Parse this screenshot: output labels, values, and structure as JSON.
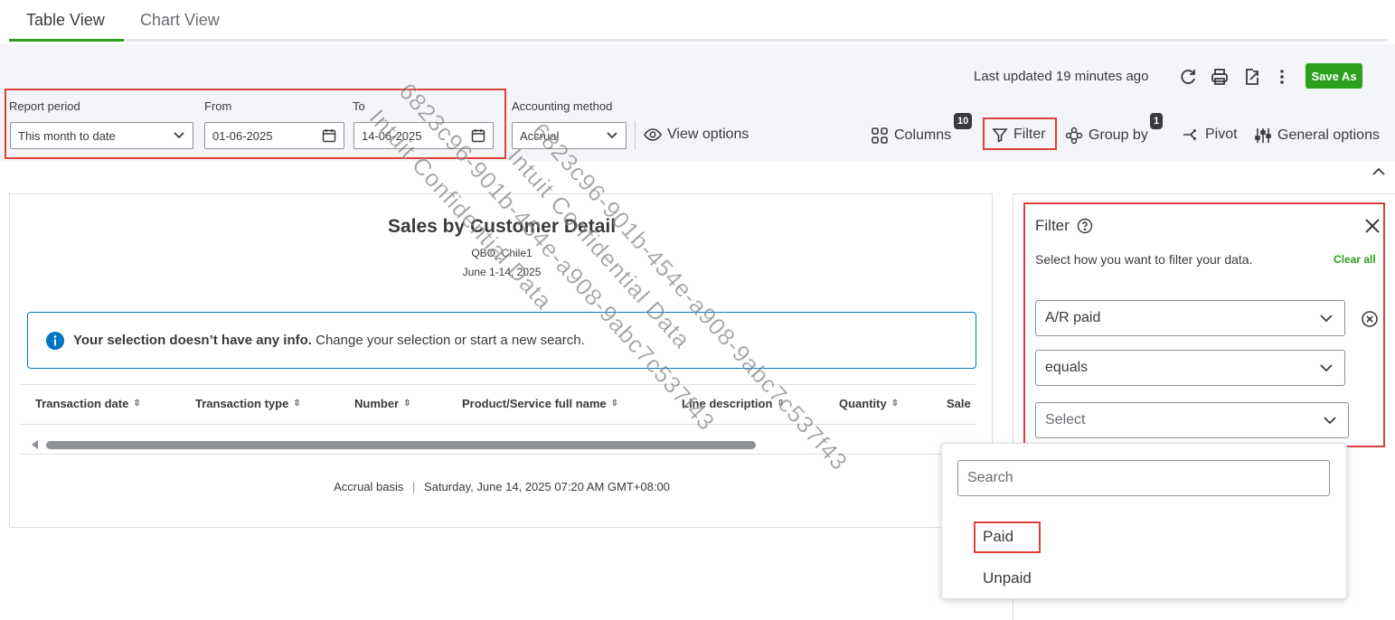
{
  "tabs": {
    "table_view": "Table View",
    "chart_view": "Chart View"
  },
  "toolbar": {
    "last_updated": "Last updated 19 minutes ago",
    "save_as": "Save As",
    "report_period_label": "Report period",
    "report_period_value": "This month to date",
    "from_label": "From",
    "from_value": "01-06-2025",
    "to_label": "To",
    "to_value": "14-06-2025",
    "accounting_method_label": "Accounting method",
    "accounting_method_value": "Accrual",
    "view_options": "View options",
    "columns": "Columns",
    "columns_count": "10",
    "filter": "Filter",
    "group_by": "Group by",
    "group_by_count": "1",
    "pivot": "Pivot",
    "general_options": "General options"
  },
  "report": {
    "title": "Sales by Customer Detail",
    "company": "QBO_Chile1",
    "date_range": "June 1-14, 2025",
    "info_bold": "Your selection doesn’t have any info.",
    "info_text": "Change your selection or start a new search.",
    "columns": [
      "Transaction date",
      "Transaction type",
      "Number",
      "Product/Service full name",
      "Line description",
      "Quantity",
      "Sale"
    ],
    "footer_basis": "Accrual basis",
    "footer_timestamp": "Saturday, June 14, 2025 07:20 AM GMT+08:00"
  },
  "filter_panel": {
    "title": "Filter",
    "description": "Select how you want to filter your data.",
    "clear_all": "Clear all",
    "field": "A/R paid",
    "operator": "equals",
    "value_placeholder": "Select",
    "search_placeholder": "Search",
    "options": [
      "Paid",
      "Unpaid"
    ]
  },
  "watermark": {
    "line1": "6823c96-901b-454e-a908-9abc7c537f43",
    "line2": "Intuit Confidential Data"
  },
  "colors": {
    "accent_green": "#2ca01c",
    "highlight_red": "#e0403a",
    "info_blue": "#0077c5"
  }
}
